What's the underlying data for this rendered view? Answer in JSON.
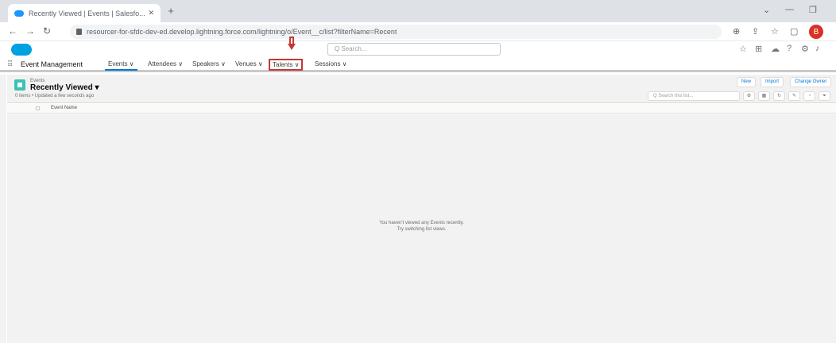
{
  "browser": {
    "tab_title": "Recently Viewed | Events | Salesfo...",
    "new_tab_label": "+",
    "url": "resourcer-for-sfdc-dev-ed.develop.lightning.force.com/lightning/o/Event__c/list?filterName=Recent",
    "profile_initial": "B"
  },
  "header": {
    "search_placeholder": "Q Search..."
  },
  "app_nav": {
    "app_name": "Event Management",
    "tabs": [
      {
        "label": "Events ∨"
      },
      {
        "label": "Attendees ∨"
      },
      {
        "label": "Speakers ∨"
      },
      {
        "label": "Venues ∨"
      },
      {
        "label": "Talents ∨"
      },
      {
        "label": "Sessions ∨"
      }
    ]
  },
  "list": {
    "object_label": "Events",
    "view_name": "Recently Viewed ▾",
    "meta": "0 items • Updated a few seconds ago",
    "buttons": {
      "new": "New",
      "import": "Import",
      "change_owner": "Change Owner"
    },
    "search_placeholder": "Q Search this list...",
    "column_header": "Event Name",
    "empty_line1": "You haven't viewed any Events recently.",
    "empty_line2": "Try switching list views."
  }
}
